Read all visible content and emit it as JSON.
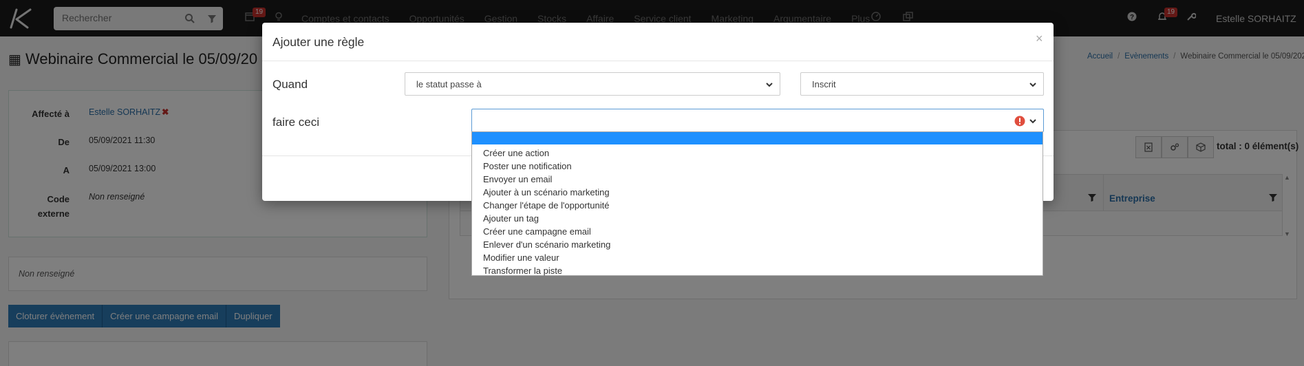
{
  "topbar": {
    "search_placeholder": "Rechercher",
    "calendar_badge": "19",
    "notif_badge": "19",
    "menu": [
      "Comptes et contacts",
      "Opportunités",
      "Gestion",
      "Stocks",
      "Affaire",
      "Service client",
      "Marketing",
      "Argumentaire",
      "Plus"
    ],
    "user_name": "Estelle SORHAITZ"
  },
  "page": {
    "title": "Webinaire Commercial le 05/09/20",
    "breadcrumb": {
      "home": "Accueil",
      "events": "Evènements",
      "current": "Webinaire Commercial le 05/09/202"
    },
    "info": {
      "assigned_label": "Affecté à",
      "assigned_value": "Estelle SORHAITZ",
      "from_label": "De",
      "from_value": "05/09/2021 11:30",
      "to_label": "A",
      "to_value": "05/09/2021 13:00",
      "code_label_1": "Code",
      "code_label_2": "externe",
      "code_value": "Non renseigné"
    },
    "description": "Non renseigné",
    "buttons": {
      "close_event": "Cloturer évènement",
      "create_campaign": "Créer une campagne email",
      "duplicate": "Dupliquer"
    },
    "total": "total : 0 élément(s)",
    "grid_column": "Entreprise"
  },
  "modal": {
    "title": "Ajouter une règle",
    "close": "×",
    "when_label": "Quand",
    "when_condition": "le statut passe à",
    "when_value": "Inscrit",
    "do_label": "faire ceci",
    "do_value": "",
    "options": [
      "Créer une action",
      "Poster une notification",
      "Envoyer un email",
      "Ajouter à un scénario marketing",
      "Changer l'étape de l'opportunité",
      "Ajouter un tag",
      "Créer une campagne email",
      "Enlever d'un scénario marketing",
      "Modifier une valeur",
      "Transformer la piste"
    ]
  },
  "colors": {
    "accent": "#2e7cb8",
    "highlight": "#1e90ff",
    "error": "#e04e3e",
    "badge": "#c9302c"
  }
}
